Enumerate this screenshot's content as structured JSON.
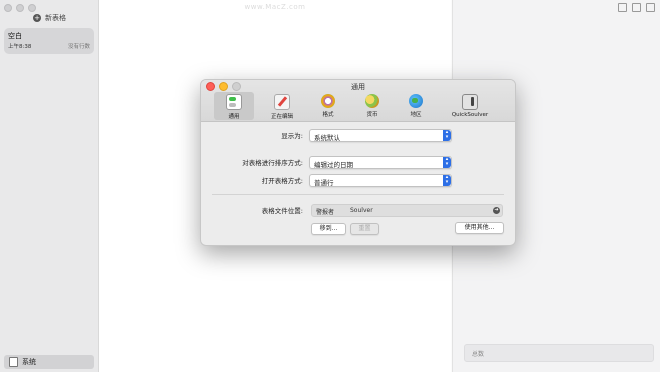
{
  "sidebar": {
    "new_sheet_label": "新表格",
    "sheet": {
      "title": "空白",
      "time": "上午8:38",
      "meta": "没有行数"
    },
    "footer_label": "系统"
  },
  "editor": {
    "watermark": "www.MacZ.com"
  },
  "results": {
    "total_placeholder": "总数"
  },
  "prefs": {
    "title": "通用",
    "tabs": [
      {
        "label": "通用",
        "icon": "general-switch-icon",
        "active": true
      },
      {
        "label": "正在编辑",
        "icon": "editing-pencil-icon",
        "active": false
      },
      {
        "label": "格式",
        "icon": "format-palette-icon",
        "active": false
      },
      {
        "label": "货币",
        "icon": "currency-coins-icon",
        "active": false
      },
      {
        "label": "地区",
        "icon": "region-globe-icon",
        "active": false
      },
      {
        "label": "QuickSoulver",
        "icon": "quicksoulver-icon",
        "active": false
      }
    ],
    "display_as_label": "显示为:",
    "display_as_value": "系统默认",
    "sort_label": "对表格进行排序方式:",
    "sort_value": "编辑过的日期",
    "open_label": "打开表格方式:",
    "open_value": "普通行",
    "location_label": "表格文件位置:",
    "location_path": [
      "警报者",
      "Soulver"
    ],
    "move_button": "移到...",
    "reset_button": "重置",
    "use_other_button": "使用其他..."
  }
}
